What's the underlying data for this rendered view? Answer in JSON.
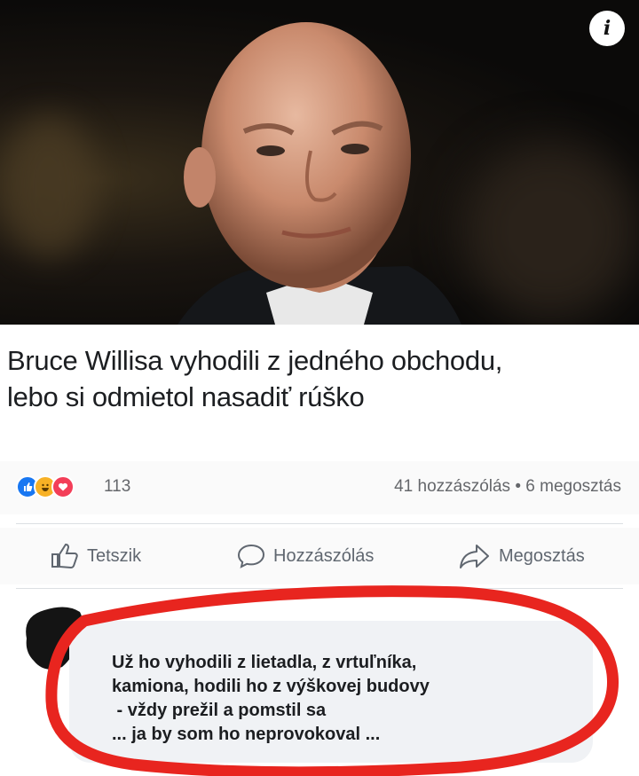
{
  "article": {
    "headline_line1": "Bruce Willisa vyhodili z jedného obchodu,",
    "headline_line2": "lebo si odmietol nasadiť rúško",
    "info_icon": "i"
  },
  "stats": {
    "reaction_icons": [
      "like-icon",
      "haha-icon",
      "love-icon"
    ],
    "reaction_count": "113",
    "comments_shares": "41 hozzászólás • 6 megosztás"
  },
  "actions": {
    "like_label": "Tetszik",
    "comment_label": "Hozzászólás",
    "share_label": "Megosztás"
  },
  "comment": {
    "lines": [
      "Už ho vyhodili z lietadla, z vrtuľníka,",
      "kamiona, hodili ho z výškovej budovy",
      " - vždy prežil a pomstil sa",
      "... ja by som ho neprovokoval ..."
    ]
  },
  "colors": {
    "like": "#1877f2",
    "haha": "#f7b125",
    "love": "#f33e58",
    "highlight_circle": "#e8251f"
  }
}
